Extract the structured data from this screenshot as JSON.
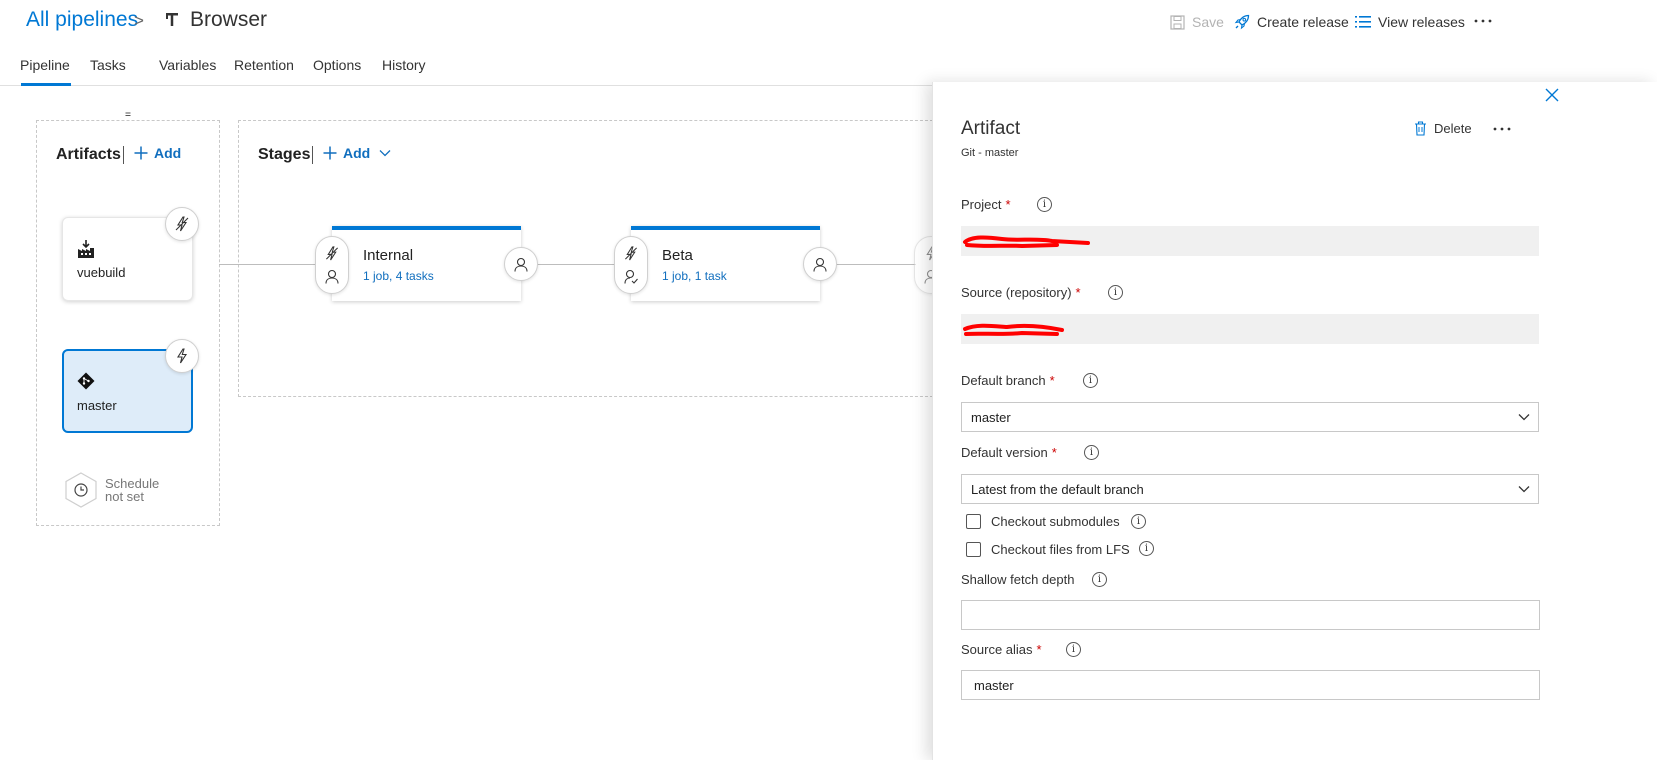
{
  "header": {
    "breadcrumb_root": "All pipelines",
    "breadcrumb_sep": ">",
    "pipeline_name": "Browser",
    "save_label": "Save",
    "create_release_label": "Create release",
    "view_releases_label": "View releases"
  },
  "tabs": [
    {
      "label": "Pipeline",
      "active": true
    },
    {
      "label": "Tasks"
    },
    {
      "label": "Variables"
    },
    {
      "label": "Retention"
    },
    {
      "label": "Options"
    },
    {
      "label": "History"
    }
  ],
  "artifacts": {
    "title": "Artifacts",
    "add_label": "Add",
    "items": [
      {
        "label": "vuebuild",
        "icon": "build-icon"
      },
      {
        "label": "master",
        "icon": "git-icon",
        "selected": true
      }
    ],
    "schedule_line1": "Schedule",
    "schedule_line2": "not set"
  },
  "stages": {
    "title": "Stages",
    "add_label": "Add",
    "items": [
      {
        "name": "Internal",
        "summary": "1 job, 4 tasks"
      },
      {
        "name": "Beta",
        "summary": "1 job, 1 task"
      }
    ]
  },
  "panel": {
    "title": "Artifact",
    "subtitle": "Git - master",
    "delete_label": "Delete",
    "project_label": "Project",
    "source_label": "Source (repository)",
    "default_branch_label": "Default branch",
    "default_branch_value": "master",
    "default_version_label": "Default version",
    "default_version_value": "Latest from the default branch",
    "checkout_submodules_label": "Checkout submodules",
    "checkout_lfs_label": "Checkout files from LFS",
    "shallow_fetch_label": "Shallow fetch depth",
    "shallow_fetch_value": "",
    "source_alias_label": "Source alias",
    "source_alias_value": "master",
    "required_mark": "*",
    "info_glyph": "i"
  },
  "colors": {
    "accent": "#0078d4",
    "link": "#106ebe",
    "selected_bg": "#deecf9",
    "required": "#cc0000",
    "redaction": "#ff0000"
  }
}
